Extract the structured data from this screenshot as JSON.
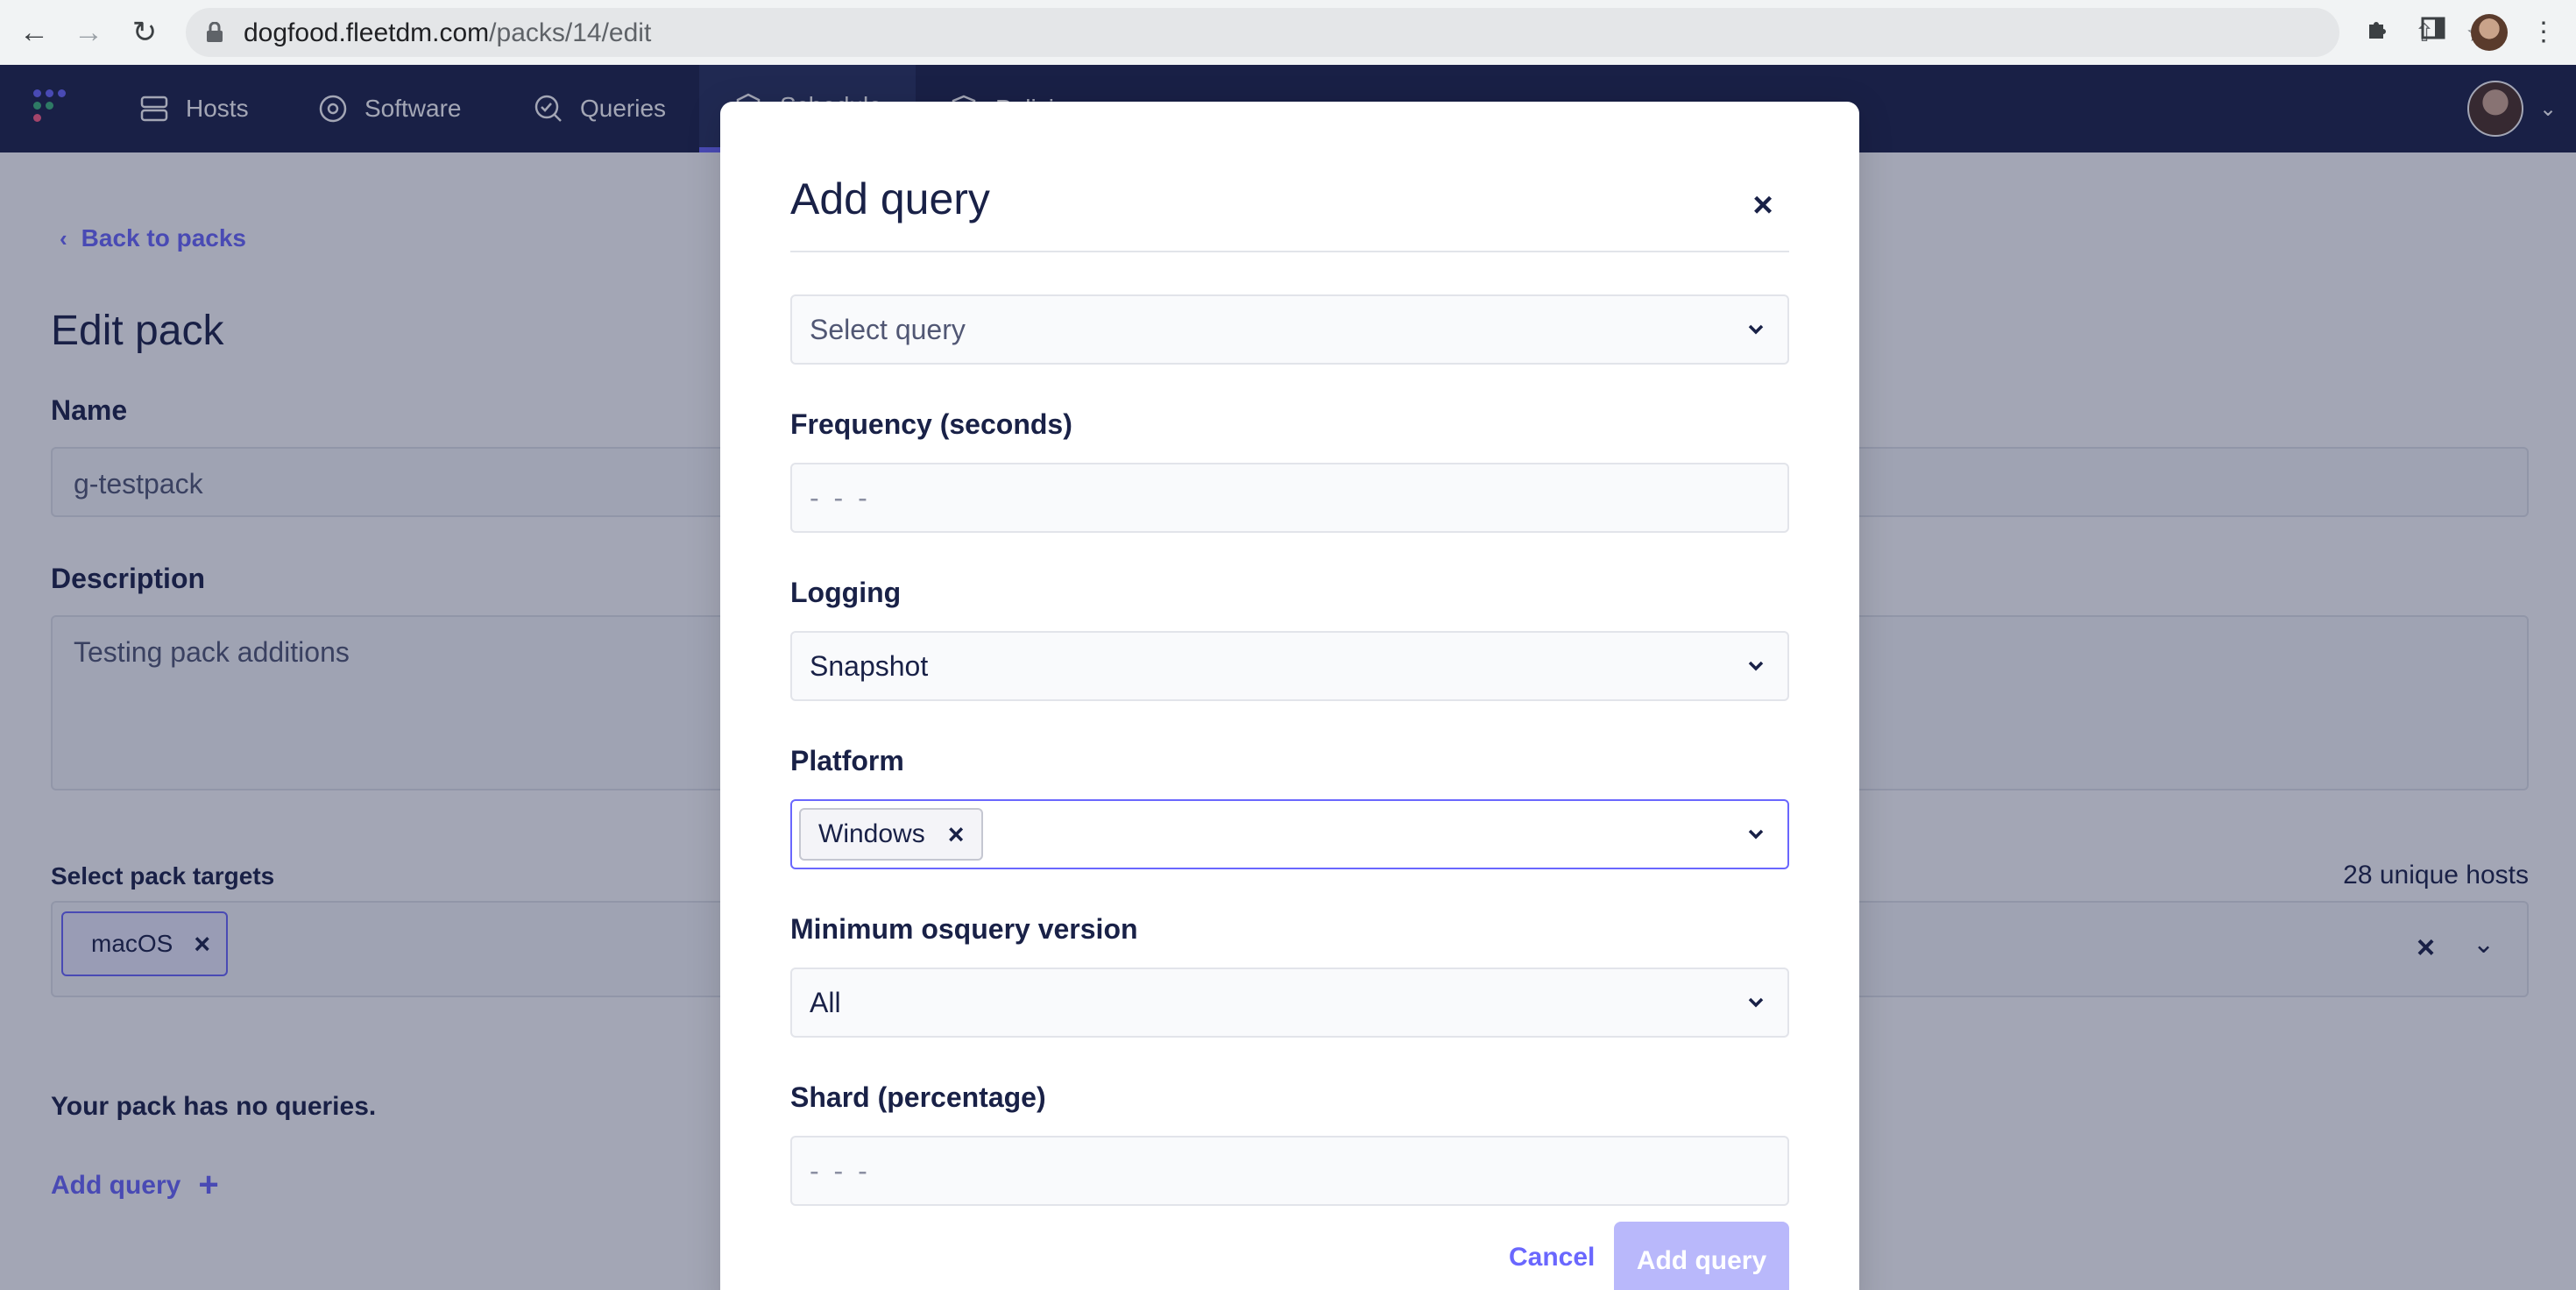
{
  "browser": {
    "url_host": "dogfood.fleetdm.com",
    "url_path": "/packs/14/edit"
  },
  "nav": {
    "items": [
      {
        "label": "Hosts",
        "icon": "hosts-icon"
      },
      {
        "label": "Software",
        "icon": "software-icon"
      },
      {
        "label": "Queries",
        "icon": "queries-icon"
      },
      {
        "label": "Schedule",
        "icon": "schedule-icon"
      },
      {
        "label": "Policies",
        "icon": "policies-icon"
      }
    ],
    "active": "Schedule"
  },
  "page": {
    "back_link": "Back to packs",
    "title": "Edit pack",
    "name_label": "Name",
    "name_value": "g-testpack",
    "description_label": "Description",
    "description_value": "Testing pack additions",
    "targets_label": "Select pack targets",
    "targets_count": "28 unique hosts",
    "target_tag": "macOS",
    "no_queries": "Your pack has no queries.",
    "add_query_link": "Add query"
  },
  "modal": {
    "title": "Add query",
    "select_query_placeholder": "Select query",
    "frequency_label": "Frequency (seconds)",
    "frequency_placeholder": "- - -",
    "logging_label": "Logging",
    "logging_value": "Snapshot",
    "platform_label": "Platform",
    "platform_tag": "Windows",
    "min_version_label": "Minimum osquery version",
    "min_version_value": "All",
    "shard_label": "Shard (percentage)",
    "shard_placeholder": "- - -",
    "cancel_label": "Cancel",
    "submit_label": "Add query"
  },
  "colors": {
    "brand_navy": "#192147",
    "accent": "#6a67fe",
    "disabled_button": "#b9b8fb"
  }
}
